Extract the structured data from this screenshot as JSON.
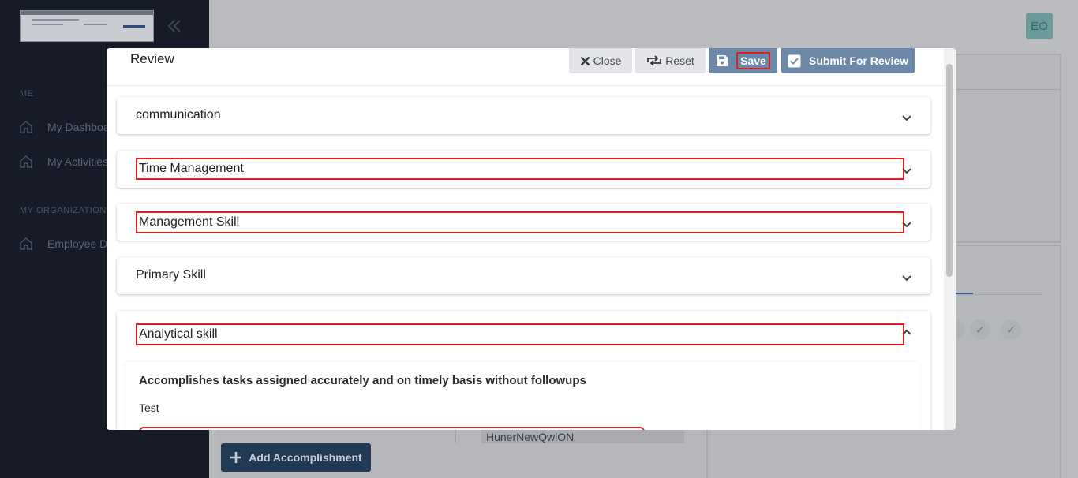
{
  "sidebar": {
    "sections": [
      "ME",
      "MY ORGANIZATION"
    ],
    "items": [
      {
        "label": "My Dashboard"
      },
      {
        "label": "My Activities"
      },
      {
        "label": "Employee Directory"
      }
    ]
  },
  "user": {
    "initials": "EO"
  },
  "background": {
    "field_value": "HunerNewQwlON",
    "add_button": "Add Accomplishment"
  },
  "modal": {
    "title": "Review",
    "buttons": {
      "close": "Close",
      "reset": "Reset",
      "save": "Save",
      "submit": "Submit For Review"
    },
    "accordions": [
      {
        "label": "communication",
        "expanded": false
      },
      {
        "label": "Time Management",
        "expanded": false
      },
      {
        "label": "Management Skill",
        "expanded": false
      },
      {
        "label": "Primary Skill",
        "expanded": false
      },
      {
        "label": "Analytical skill",
        "expanded": true
      }
    ],
    "detail": {
      "question": "Accomplishes tasks assigned accurately and on timely basis without followups",
      "answer": "Test"
    }
  },
  "colors": {
    "highlight": "#e02020",
    "primary_button": "#6d87a6",
    "sidebar_bg": "#161b27"
  }
}
